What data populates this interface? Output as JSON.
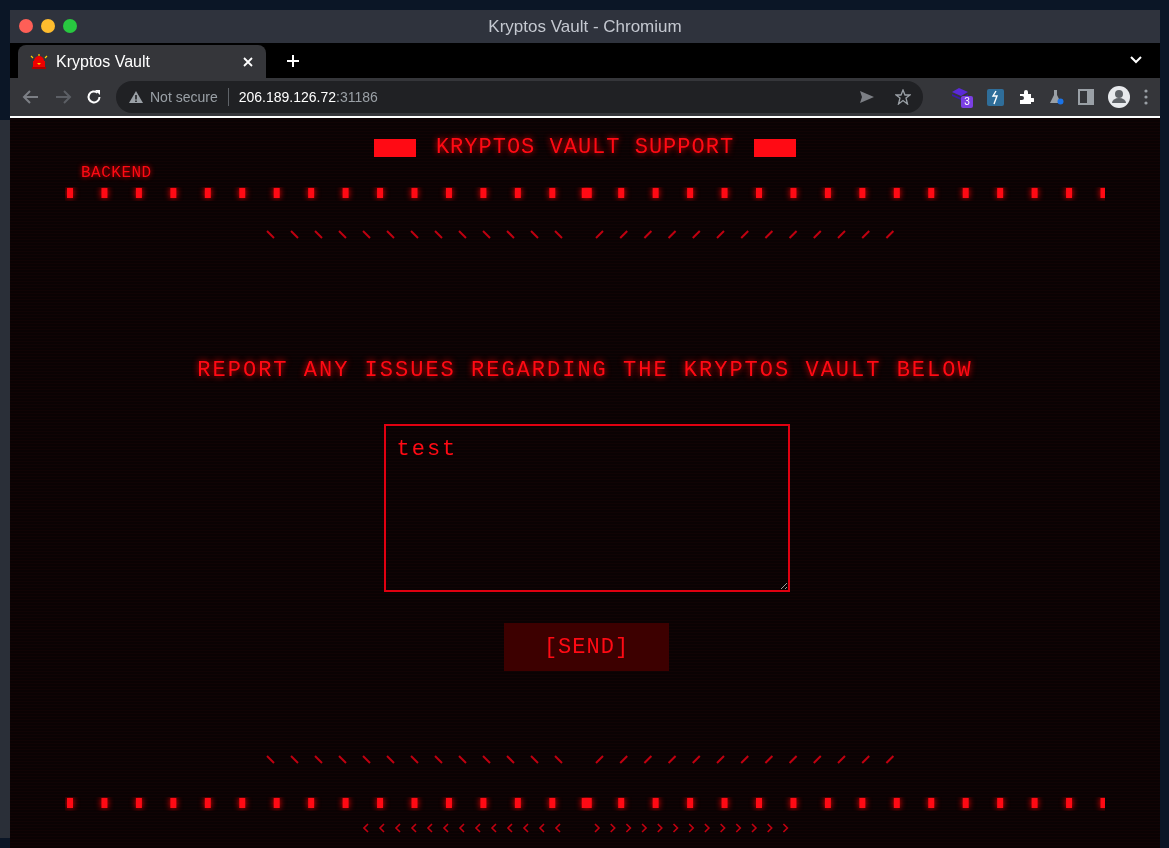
{
  "window": {
    "title": "Kryptos Vault - Chromium"
  },
  "tabs": [
    {
      "label": "Kryptos Vault",
      "selected": true
    }
  ],
  "address_bar": {
    "security": "Not secure",
    "host": "206.189.126.72",
    "port": ":31186"
  },
  "extensions": [
    {
      "badge": "3"
    }
  ],
  "page": {
    "title": "KRYPTOS VAULT SUPPORT",
    "nav_label": "BACKEND",
    "heading": "REPORT ANY ISSUES REGARDING THE KRYPTOS VAULT BELOW",
    "message": {
      "value": "test"
    },
    "send_button": "[SEND]"
  }
}
